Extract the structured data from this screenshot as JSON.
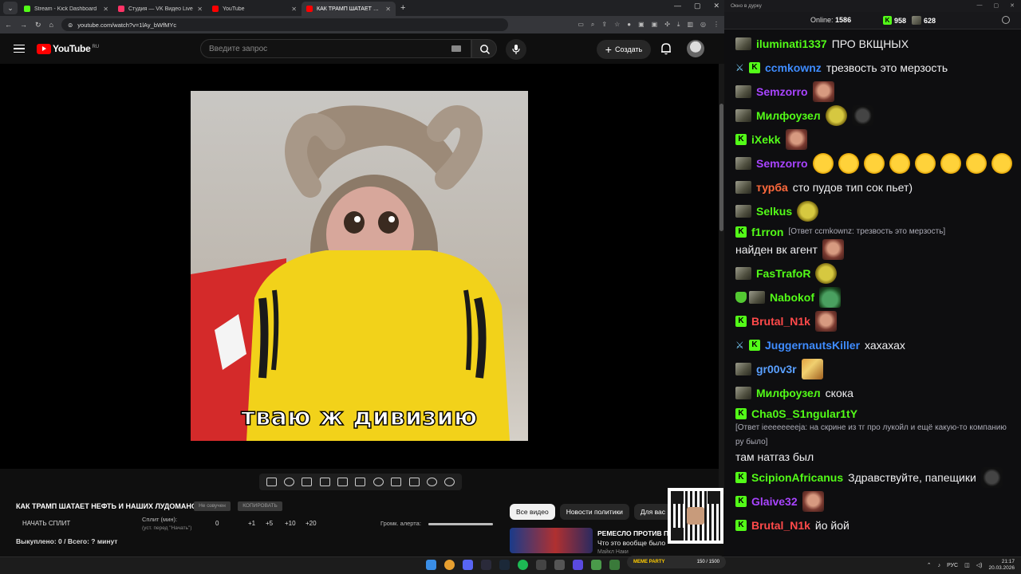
{
  "browser": {
    "tabs": [
      {
        "title": "Stream - Kick Dashboard",
        "color": "#53fc18",
        "active": false
      },
      {
        "title": "Студия — VK Видео Live",
        "color": "#ff3366",
        "active": false
      },
      {
        "title": "YouTube",
        "color": "#ff0000",
        "active": false
      },
      {
        "title": "КАК ТРАМП ШАТАЕТ НЕФ",
        "color": "#ff0000",
        "active": true
      }
    ],
    "url": "youtube.com/watch?v=1lAy_bWfMYc"
  },
  "youtube": {
    "logo_text": "YouTube",
    "logo_region": "RU",
    "search_placeholder": "Введите запрос",
    "create_label": "Создать",
    "video_caption": "тваю ж дивизию",
    "video_title": "КАК ТРАМП ШАТАЕТ НЕФТЬ И НАШИХ ЛУДОМАНОВ",
    "chip_no_sound": "Не озвучен",
    "chip_copy": "КОПИРОВАТЬ",
    "split_button": "НАЧАТЬ СПЛИТ",
    "split_label": "Сплит (мин):",
    "split_sub": "(уст. перед \"Начать\")",
    "split_values": [
      "0",
      "+1",
      "+5",
      "+10",
      "+20"
    ],
    "volume_label": "Громк. алерта:",
    "volume_level": 1.0,
    "bought": "Выкуплено: 0 / Всего: ? минут",
    "chips": [
      "Все видео",
      "Новости политики",
      "Для вас"
    ],
    "rec_title": "РЕМЕСЛО ПРОТИВ ПУ",
    "rec_subtitle": "Что это вообще было",
    "rec_author": "Майкл Наки"
  },
  "chat": {
    "window_title": "Окно в дурку",
    "online_label": "Online:",
    "online_count": "1586",
    "kick_count": "958",
    "other_count": "628",
    "messages": [
      {
        "badges": [
          "g"
        ],
        "user": "iluminati1337",
        "color": "#53fc18",
        "text": "ПРО ВКЩНЫХ",
        "emotes": []
      },
      {
        "badges": [
          "sword",
          "k"
        ],
        "user": "ccmkownz",
        "color": "#3f8cff",
        "text": "трезвость это мерзость",
        "emotes": []
      },
      {
        "badges": [
          "g"
        ],
        "user": "Semzorro",
        "color": "#a844ff",
        "text": "",
        "emotes": [
          "face"
        ]
      },
      {
        "badges": [
          "g"
        ],
        "user": "Милфоузел",
        "color": "#53fc18",
        "text": "",
        "emotes": [
          "pepe",
          "cat"
        ]
      },
      {
        "badges": [
          "k"
        ],
        "user": "iXekk",
        "color": "#53fc18",
        "text": "",
        "emotes": [
          "face"
        ]
      },
      {
        "badges": [
          "g"
        ],
        "user": "Semzorro",
        "color": "#a844ff",
        "text": "",
        "emotes": [
          "laugh",
          "laugh",
          "laugh",
          "laugh",
          "laugh",
          "laugh",
          "laugh",
          "laugh"
        ]
      },
      {
        "badges": [
          "g"
        ],
        "user": "турба",
        "color": "#ff6a3d",
        "text": "сто пудов тип сок пьет)",
        "emotes": []
      },
      {
        "badges": [
          "g"
        ],
        "user": "Selkus",
        "color": "#53fc18",
        "text": "",
        "emotes": [
          "pepe"
        ]
      },
      {
        "badges": [
          "k"
        ],
        "user": "f1rron",
        "color": "#53fc18",
        "reply": "[Ответ ccmkownz: трезвость это мерзость]",
        "text": "найден вк агент",
        "emotes": [
          "face"
        ]
      },
      {
        "badges": [
          "g"
        ],
        "user": "FasTrafoR",
        "color": "#53fc18",
        "text": "",
        "emotes": [
          "pepe"
        ]
      },
      {
        "badges": [
          "shield",
          "g"
        ],
        "user": "Nabokof",
        "color": "#53fc18",
        "text": "",
        "emotes": [
          "frog"
        ]
      },
      {
        "badges": [
          "k"
        ],
        "user": "Brutal_N1k",
        "color": "#ff4a4a",
        "text": "",
        "emotes": [
          "face"
        ]
      },
      {
        "badges": [
          "sword",
          "k"
        ],
        "user": "JuggernautsKiller",
        "color": "#3f8cff",
        "text": "хахахах",
        "emotes": []
      },
      {
        "badges": [
          "g"
        ],
        "user": "gr00v3r",
        "color": "#5aa0ff",
        "text": "",
        "emotes": [
          "tiger"
        ]
      },
      {
        "badges": [
          "g"
        ],
        "user": "Милфоузел",
        "color": "#53fc18",
        "text": "скока",
        "emotes": []
      },
      {
        "badges": [
          "k"
        ],
        "user": "Cha0S_S1ngular1tY",
        "color": "#53fc18",
        "reply": "[Ответ ieeeeeeeeja: на скрине из тг про лукойл и ещё какую-то компанию ру было]",
        "text": "там натгаз был",
        "emotes": []
      },
      {
        "badges": [
          "k"
        ],
        "user": "ScipionAfricanus",
        "color": "#53fc18",
        "text": "Здравствуйте, папещики",
        "emotes": [
          "cat"
        ]
      },
      {
        "badges": [
          "k"
        ],
        "user": "Glaive32",
        "color": "#a844ff",
        "text": "",
        "emotes": [
          "face"
        ]
      },
      {
        "badges": [
          "k"
        ],
        "user": "Brutal_N1k",
        "color": "#ff4a4a",
        "text": "йо йой",
        "emotes": []
      }
    ]
  },
  "taskbar": {
    "lang": "РУС",
    "time": "21:17",
    "date": "20.03.2026",
    "meme_label": "MEME PARTY",
    "meme_counter": "150 / 1500"
  }
}
